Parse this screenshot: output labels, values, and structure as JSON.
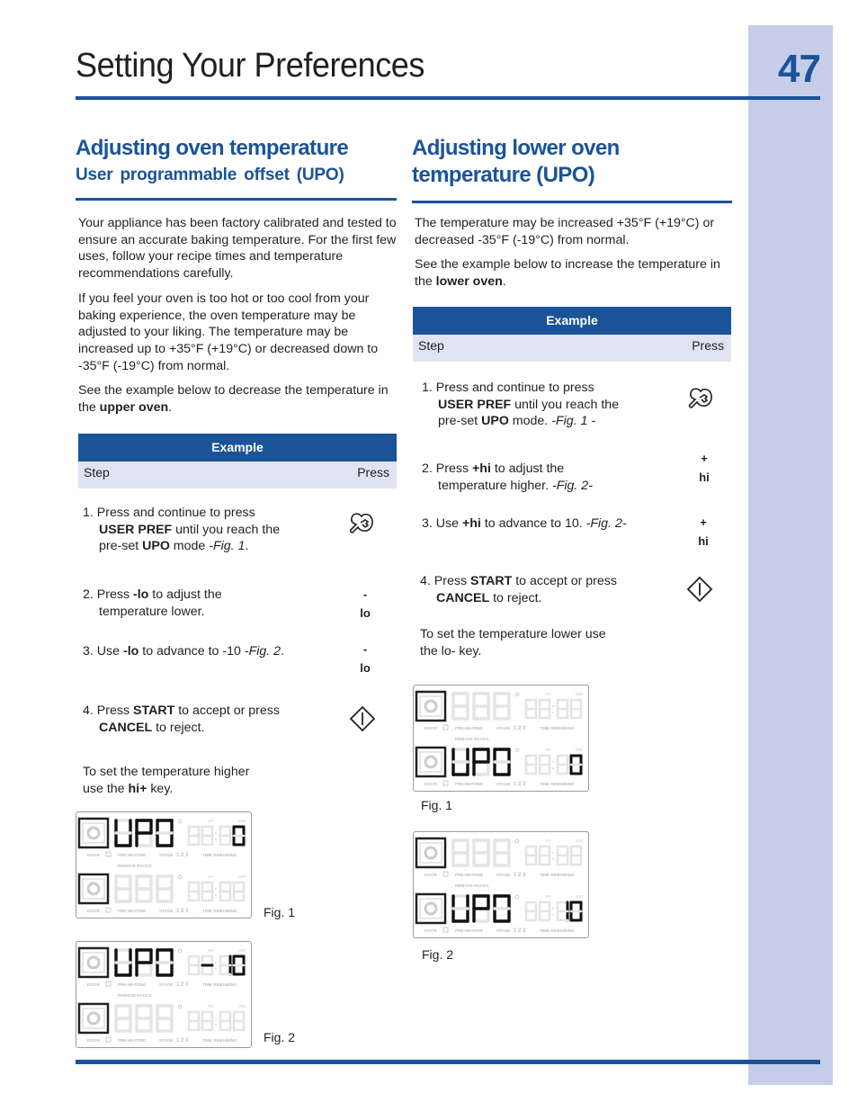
{
  "page": {
    "title": "Setting Your Preferences",
    "number": "47",
    "colors": {
      "accent": "#1b5399",
      "band": "#c5cde8",
      "table_sub": "#dfe3f2"
    }
  },
  "left": {
    "heading": "Adjusting oven temperature",
    "subheading": "User programmable offset (UPO)",
    "paragraphs": [
      "Your appliance has been factory calibrated and tested to ensure an accurate baking temperature. For the first few uses, follow your recipe times and temperature recommendations carefully.",
      "If you feel your oven is too hot or too cool from your baking experience, the oven temperature may be adjusted to your liking. The temperature may be increased  up to +35°F (+19°C) or decreased down to -35°F (-19°C) from normal."
    ],
    "intro_pre": "See the example below to decrease the temperature in the ",
    "intro_bold": "upper oven",
    "intro_post": ".",
    "table": {
      "title": "Example",
      "col_step": "Step",
      "col_press": "Press",
      "steps": [
        {
          "n": "1.",
          "t1": "Press and continue to press ",
          "b1": "USER PREF",
          "t2": " until you reach the pre-set ",
          "b2": "UPO",
          "t3": " mode ",
          "fig": "-Fig. 1",
          "t4": ".",
          "key_icon": "user-pref-wrench-icon"
        },
        {
          "n": "2.",
          "t1": "Press ",
          "b1": "-lo",
          "t2": " to adjust the temperature lower.",
          "key_sym": "-",
          "key_label": "lo"
        },
        {
          "n": "3.",
          "t1": "Use ",
          "b1": "-lo",
          "t2": " to advance to -10 ",
          "fig": "-Fig. 2",
          "t3": ".",
          "key_sym": "-",
          "key_label": "lo"
        },
        {
          "n": "4.",
          "t1": "Press ",
          "b1": "START",
          "t2": " to accept or press ",
          "b2": "CANCEL",
          "t3": " to reject.",
          "key_icon": "start-diamond-icon"
        }
      ]
    },
    "note_pre": "To set the temperature higher use the ",
    "note_bold": "hi+",
    "note_post": " key.",
    "figures": [
      {
        "label": "Fig. 1",
        "upper": {
          "temp": "UPO",
          "time": "0",
          "active": true
        },
        "lower": {
          "temp": "888",
          "time": "88:88",
          "active": false
        }
      },
      {
        "label": "Fig. 2",
        "upper": {
          "temp": "UPO",
          "time": "-10",
          "active": true
        },
        "lower": {
          "temp": "888",
          "time": "88:88",
          "active": false
        }
      }
    ]
  },
  "right": {
    "heading_line1": "Adjusting lower oven",
    "heading_line2": "temperature (UPO)",
    "paragraphs": [
      "The temperature may be increased  +35°F (+19°C) or decreased -35°F (-19°C) from normal."
    ],
    "intro_pre": "See the example below to increase the temperature in the ",
    "intro_bold": "lower oven",
    "intro_post": ".",
    "table": {
      "title": "Example",
      "col_step": "Step",
      "col_press": "Press",
      "steps": [
        {
          "n": "1.",
          "t1": "Press and continue to press ",
          "b1": "USER PREF",
          "t2": " until you reach the pre-set ",
          "b2": "UPO",
          "t3": " mode. ",
          "fig": "-Fig. 1 -",
          "key_icon": "user-pref-wrench-icon"
        },
        {
          "n": "2.",
          "t1": "Press ",
          "b1": "+hi",
          "t2": " to adjust the temperature higher. ",
          "fig": "-Fig. 2-",
          "key_sym": "+",
          "key_label": "hi"
        },
        {
          "n": "3.",
          "t1": "Use ",
          "b1": "+hi",
          "t2": " to advance to 10. ",
          "fig": "-Fig. 2-",
          "key_sym": "+",
          "key_label": "hi"
        },
        {
          "n": "4.",
          "t1": "Press ",
          "b1": "START",
          "t2": " to accept or press ",
          "b2": "CANCEL",
          "t3": " to reject.",
          "key_icon": "start-diamond-icon"
        }
      ]
    },
    "note": "To set the temperature lower use the lo- key.",
    "figures": [
      {
        "label": "Fig. 1",
        "upper": {
          "temp": "888",
          "time": "88:88",
          "active": false
        },
        "lower": {
          "temp": "UPO",
          "time": "0",
          "active": true
        }
      },
      {
        "label": "Fig. 2",
        "upper": {
          "temp": "888",
          "time": "88:88",
          "active": false
        },
        "lower": {
          "temp": "UPO",
          "time": "10",
          "active": true
        }
      }
    ]
  },
  "display_labels": {
    "door": "DOOR",
    "preheating": "PRE-HEATING",
    "stage": "STAGE",
    "stage_nums": "1 2 3",
    "time_remaining": "TIME REMAINING",
    "remove_racks": "REMOVE RACKS",
    "hr": "HR",
    "min": "MIN"
  }
}
